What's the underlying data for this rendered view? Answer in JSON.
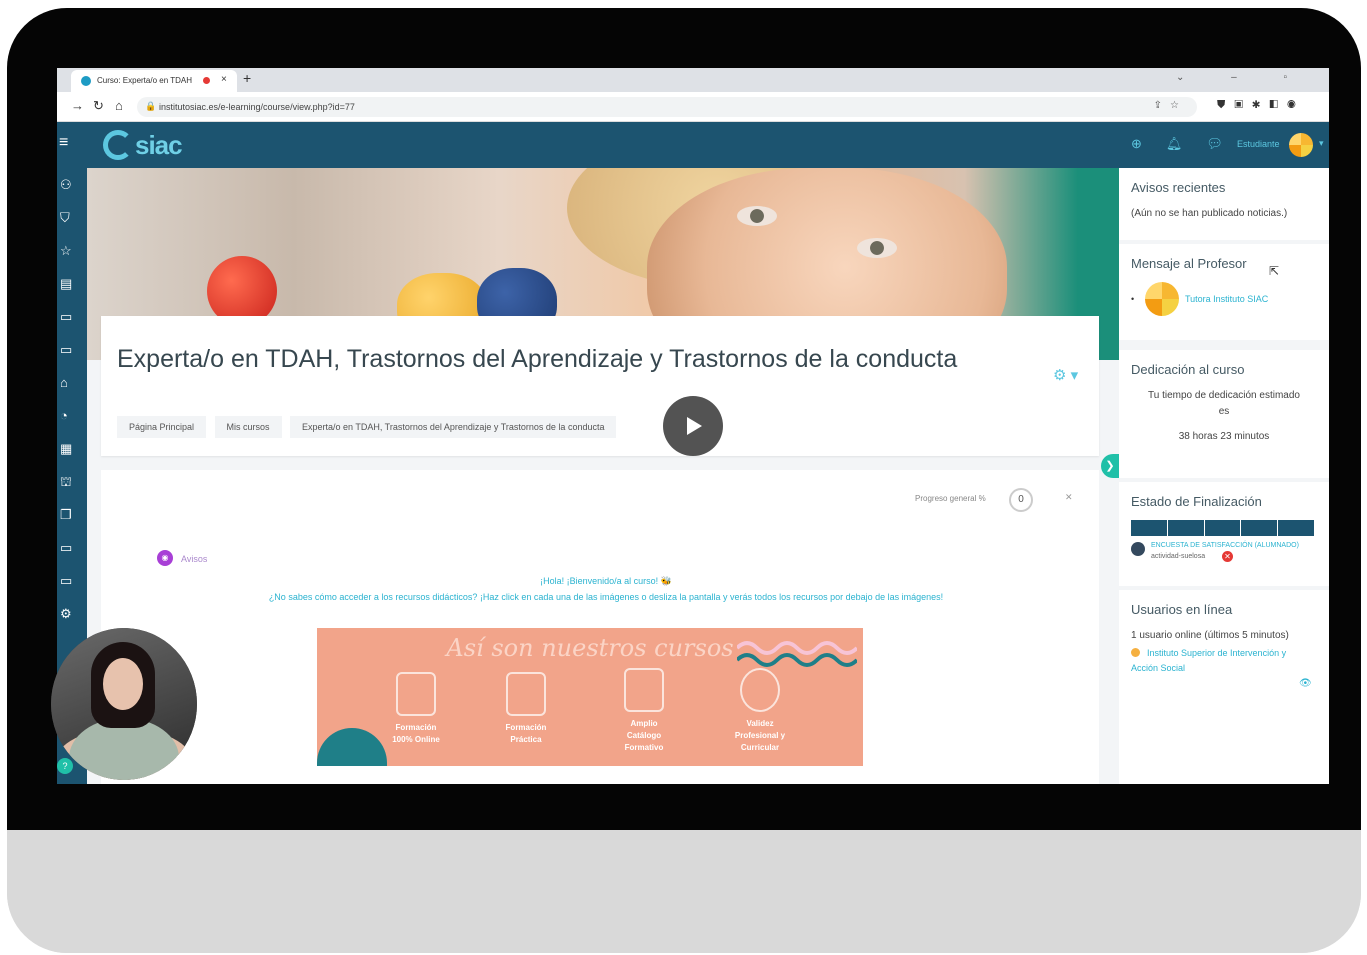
{
  "browser": {
    "tab_title": "Curso: Experta/o en TDAH",
    "tab_close": "×",
    "new_tab": "+",
    "window_controls": "⌄ – ▫",
    "url": "institutosiac.es/e-learning/course/view.php?id=77"
  },
  "navbar": {
    "brand": "siac",
    "user_label": "Estudiante"
  },
  "course": {
    "title": "Experta/o en TDAH, Trastornos del Aprendizaje y Trastornos de la conducta",
    "breadcrumb": [
      "Página Principal",
      "Mis cursos",
      "Experta/o en TDAH, Trastornos del Aprendizaje y Trastornos de la conducta"
    ]
  },
  "content": {
    "progress_label": "Progreso general %",
    "progress_value": "0",
    "avisos_label": "Avisos",
    "welcome": "¡Hola! ¡Bienvenido/a al curso! 🐝",
    "instructions": "¿No sabes cómo acceder a los recursos didácticos? ¡Haz click en cada una de las imágenes o desliza la pantalla y verás todos los recursos por debajo de las imágenes!"
  },
  "banner": {
    "headline": "Así son nuestros cursos",
    "features": [
      {
        "label": "Formación\n100% Online",
        "icon": "laptop-icon"
      },
      {
        "label": "Formación\nPráctica",
        "icon": "gears-head-icon"
      },
      {
        "label": "Amplio\nCatálogo\nFormativo",
        "icon": "catalog-icon"
      },
      {
        "label": "Validez\nProfesional y\nCurricular",
        "icon": "badge-icon"
      }
    ]
  },
  "sidebar_blocks": {
    "avisos": {
      "title": "Avisos recientes",
      "text": "(Aún no se han publicado noticias.)"
    },
    "mensaje": {
      "title": "Mensaje al Profesor",
      "tutor": "Tutora Instituto SIAC"
    },
    "dedicacion": {
      "title": "Dedicación al curso",
      "line1": "Tu tiempo de dedicación estimado",
      "line2": "es",
      "time": "38 horas 23 minutos"
    },
    "finalizacion": {
      "title": "Estado de Finalización",
      "segments": 5,
      "caption1": "ENCUESTA DE SATISFACCIÓN (ALUMNADO)",
      "caption2": "actividad-suelosa"
    },
    "usuarios": {
      "title": "Usuarios en línea",
      "text": "1 usuario online (últimos 5 minutos)",
      "user": "Instituto Superior de Intervención y Acción Social"
    }
  },
  "colors": {
    "navbar": "#1c5470",
    "accent": "#5cc7e0",
    "banner": "#f2a48a"
  }
}
